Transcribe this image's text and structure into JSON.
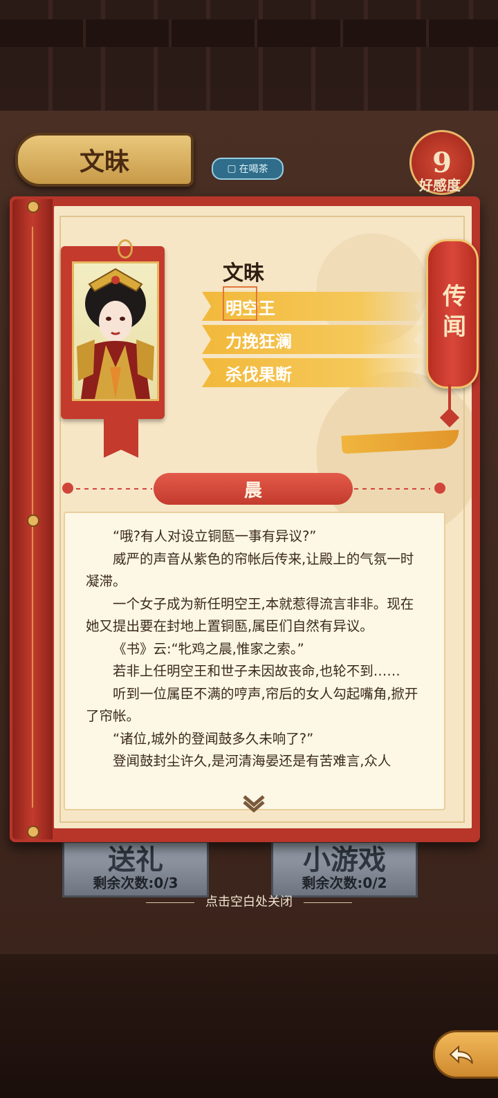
{
  "header": {
    "character_name": "文昧",
    "status_text": "在喝茶",
    "favor_value": "9",
    "favor_label": "好感度"
  },
  "profile": {
    "name": "文昧",
    "traits": [
      "明空王",
      "力挽狂澜",
      "杀伐果断"
    ]
  },
  "rumor_tab": "传闻",
  "chapter": {
    "title": "晨",
    "paragraphs": [
      "“哦?有人对设立铜匦一事有异议?”",
      "威严的声音从紫色的帘帐后传来,让殿上的气氛一时凝滞。",
      "一个女子成为新任明空王,本就惹得流言非非。现在她又提出要在封地上置铜匦,属臣们自然有异议。",
      "《书》云:“牝鸡之晨,惟家之索。”",
      "若非上任明空王和世子未因故丧命,也轮不到……",
      "听到一位属臣不满的哼声,帘后的女人勾起嘴角,掀开了帘帐。",
      "“诸位,城外的登闻鼓多久未响了?”",
      "登闻鼓封尘许久,是河清海晏还是有苦难言,众人"
    ]
  },
  "bottom": {
    "gift_label": "送礼",
    "gift_remaining": "剩余次数:0/3",
    "minigame_label": "小游戏",
    "minigame_remaining": "剩余次数:0/2",
    "close_hint": "点击空白处关闭"
  },
  "colors": {
    "book_red": "#b8352a",
    "page_cream": "#f6e6c6",
    "trait_gold": "#f2b93b",
    "banner_red": "#e35a4a"
  }
}
